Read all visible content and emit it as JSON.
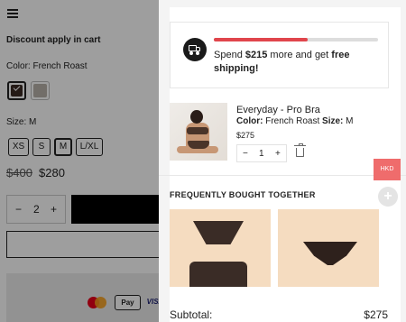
{
  "product": {
    "discount_note": "Discount apply in cart",
    "color_label": "Color:",
    "color_value": "French Roast",
    "swatch_colors": [
      "#3b2a24",
      "#b9b2aa"
    ],
    "size_label": "Size:",
    "size_value": "M",
    "sizes": [
      "XS",
      "S",
      "M",
      "L/XL"
    ],
    "selected_size": "M",
    "price_old": "$400",
    "price_new": "$280",
    "quantity": "2",
    "qty_minus": "−",
    "qty_plus": "+",
    "payments": {
      "apple_pay": "Pay",
      "visa": "VISA"
    }
  },
  "cart": {
    "shipping": {
      "progress_percent": 57,
      "prefix": "Spend ",
      "amount": "$215",
      "middle": " more and get ",
      "reward": "free shipping!"
    },
    "item": {
      "name": "Everyday - Pro Bra",
      "variant_color_label": "Color:",
      "variant_color": "French Roast",
      "variant_size_label": "Size:",
      "variant_size": "M",
      "price": "$275",
      "quantity": "1",
      "qty_minus": "−",
      "qty_plus": "+"
    },
    "fbt_title": "FREQUENTLY BOUGHT TOGETHER",
    "subtotal_label": "Subtotal:",
    "subtotal_value": "$275"
  },
  "currency_tab": "HKD",
  "floating_plus": "+",
  "colors": {
    "accent_red": "#e0454c",
    "currency_tab": "#ef6c6c"
  }
}
